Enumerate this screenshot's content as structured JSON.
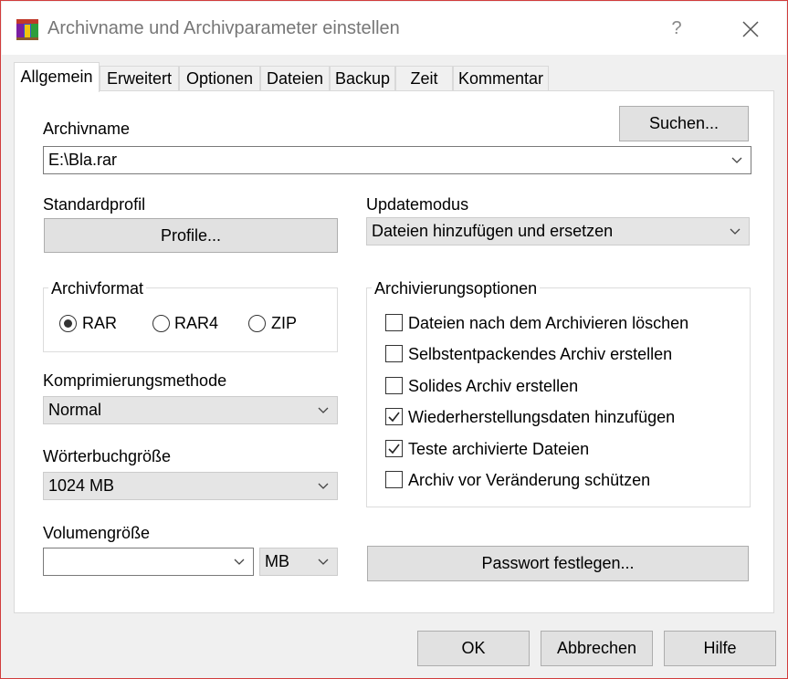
{
  "window": {
    "title": "Archivname und Archivparameter einstellen",
    "help_label": "?",
    "accent_border": "#d13c3c"
  },
  "tabs": [
    {
      "label": "Allgemein",
      "active": true
    },
    {
      "label": "Erweitert"
    },
    {
      "label": "Optionen"
    },
    {
      "label": "Dateien"
    },
    {
      "label": "Backup"
    },
    {
      "label": "Zeit"
    },
    {
      "label": "Kommentar"
    }
  ],
  "archive": {
    "name_label": "Archivname",
    "browse_label": "Suchen...",
    "name_value": "E:\\Bla.rar"
  },
  "profile": {
    "label": "Standardprofil",
    "button_label": "Profile..."
  },
  "update": {
    "label": "Updatemodus",
    "value": "Dateien hinzufügen und ersetzen"
  },
  "format": {
    "title": "Archivformat",
    "options": [
      {
        "label": "RAR",
        "selected": true
      },
      {
        "label": "RAR4",
        "selected": false
      },
      {
        "label": "ZIP",
        "selected": false
      }
    ]
  },
  "compression": {
    "label": "Komprimierungsmethode",
    "value": "Normal"
  },
  "dictionary": {
    "label": "Wörterbuchgröße",
    "value": "1024 MB"
  },
  "volume": {
    "label": "Volumengröße",
    "value": "",
    "unit": "MB"
  },
  "options": {
    "title": "Archivierungsoptionen",
    "items": [
      {
        "label": "Dateien nach dem Archivieren löschen",
        "checked": false
      },
      {
        "label": "Selbstentpackendes Archiv erstellen",
        "checked": false
      },
      {
        "label": "Solides Archiv erstellen",
        "checked": false
      },
      {
        "label": "Wiederherstellungsdaten hinzufügen",
        "checked": true
      },
      {
        "label": "Teste archivierte Dateien",
        "checked": true
      },
      {
        "label": "Archiv vor Veränderung schützen",
        "checked": false
      }
    ]
  },
  "password": {
    "button_label": "Passwort festlegen..."
  },
  "footer": {
    "ok_label": "OK",
    "cancel_label": "Abbrechen",
    "help_label": "Hilfe"
  }
}
